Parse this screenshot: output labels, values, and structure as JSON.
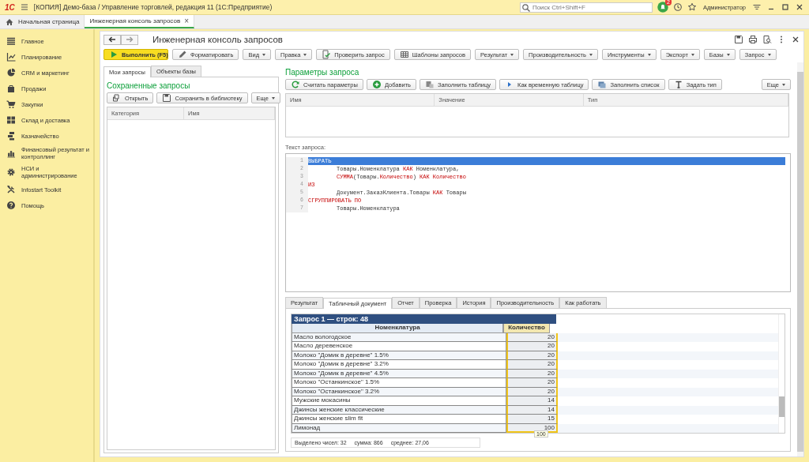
{
  "app": {
    "logo": "1С",
    "title": "[КОПИЯ] Демо-база / Управление торговлей, редакция 11  (1С:Предприятие)",
    "search": {
      "placeholder": "Поиск Ctrl+Shift+F"
    },
    "notifications": "2",
    "user": "Администратор"
  },
  "open_tabs": [
    {
      "label": "Начальная страница",
      "selected": false,
      "closable": false
    },
    {
      "label": "Инженерная консоль запросов",
      "selected": true,
      "closable": true,
      "close": "×"
    }
  ],
  "sidebar": {
    "items": [
      {
        "label": "Главное",
        "selected": false
      },
      {
        "label": "Планирование",
        "selected": false
      },
      {
        "label": "CRM и маркетинг",
        "selected": false
      },
      {
        "label": "Продажи",
        "selected": false
      },
      {
        "label": "Закупки",
        "selected": false
      },
      {
        "label": "Склад и доставка",
        "selected": false
      },
      {
        "label": "Казначейство",
        "selected": false
      },
      {
        "label": "Финансовый результат и контроллинг",
        "selected": false
      },
      {
        "label": "НСИ и администрирование",
        "selected": false
      },
      {
        "label": "Infostart Toolkit",
        "selected": false
      },
      {
        "label": "Помощь",
        "selected": false
      }
    ]
  },
  "form": {
    "title": "Инженерная консоль запросов",
    "toolbar": [
      {
        "label": "Выполнить (F5)",
        "primary": true,
        "dropdown": false
      },
      {
        "label": "Форматировать",
        "primary": false,
        "dropdown": false
      },
      {
        "label": "Вид",
        "primary": false,
        "dropdown": true
      },
      {
        "label": "Правка",
        "primary": false,
        "dropdown": true
      },
      {
        "label": "Проверить запрос",
        "primary": false,
        "dropdown": false
      },
      {
        "label": "Шаблоны запросов",
        "primary": false,
        "dropdown": false
      },
      {
        "label": "Результат",
        "primary": false,
        "dropdown": true
      },
      {
        "label": "Производительность",
        "primary": false,
        "dropdown": true
      },
      {
        "label": "Инструменты",
        "primary": false,
        "dropdown": true
      },
      {
        "label": "Экспорт",
        "primary": false,
        "dropdown": true
      },
      {
        "label": "Базы",
        "primary": false,
        "dropdown": true
      },
      {
        "label": "Запрос",
        "primary": false,
        "dropdown": true
      }
    ]
  },
  "left_panel": {
    "tabs": [
      {
        "label": "Мои запросы",
        "selected": true
      },
      {
        "label": "Объекты базы",
        "selected": false
      }
    ],
    "heading": "Сохраненные запросы",
    "buttons": [
      {
        "label": "Открыть"
      },
      {
        "label": "Сохранить в библиотеку"
      }
    ],
    "more": "Еще",
    "columns": [
      "Категория",
      "Имя"
    ]
  },
  "params": {
    "heading": "Параметры запроса",
    "buttons": [
      {
        "label": "Считать параметры"
      },
      {
        "label": "Добавить"
      },
      {
        "label": "Заполнить таблицу"
      },
      {
        "label": "Как временную таблицу"
      },
      {
        "label": "Заполнить список"
      },
      {
        "label": "Задать тип"
      }
    ],
    "more": "Еще",
    "columns": [
      "Имя",
      "Значение",
      "Тип"
    ]
  },
  "query": {
    "label": "Текст запроса:",
    "lines": [
      {
        "number": "1",
        "indented": false,
        "selected": true,
        "segments": [
          {
            "text": "ВЫБРАТЬ",
            "kind": "keyword"
          }
        ]
      },
      {
        "number": "2",
        "indented": true,
        "selected": false,
        "segments": [
          {
            "text": "Товары.Номенклатура ",
            "kind": "plain"
          },
          {
            "text": "КАК",
            "kind": "keyword"
          },
          {
            "text": " Номенклатура,",
            "kind": "plain"
          }
        ]
      },
      {
        "number": "3",
        "indented": true,
        "selected": false,
        "segments": [
          {
            "text": "СУММА",
            "kind": "keyword"
          },
          {
            "text": "(Товары.",
            "kind": "plain"
          },
          {
            "text": "Количество",
            "kind": "keyword"
          },
          {
            "text": ") ",
            "kind": "plain"
          },
          {
            "text": "КАК Количество",
            "kind": "keyword"
          }
        ]
      },
      {
        "number": "4",
        "indented": false,
        "selected": false,
        "segments": [
          {
            "text": "ИЗ",
            "kind": "keyword"
          }
        ]
      },
      {
        "number": "5",
        "indented": true,
        "selected": false,
        "segments": [
          {
            "text": "Документ.ЗаказКлиента.Товары ",
            "kind": "plain"
          },
          {
            "text": "КАК",
            "kind": "keyword"
          },
          {
            "text": " Товары",
            "kind": "plain"
          }
        ]
      },
      {
        "number": "6",
        "indented": false,
        "selected": false,
        "segments": [
          {
            "text": "СГРУППИРОВАТЬ ПО",
            "kind": "keyword"
          }
        ]
      },
      {
        "number": "7",
        "indented": true,
        "selected": false,
        "segments": [
          {
            "text": "Товары.Номенклатура",
            "kind": "plain"
          }
        ]
      }
    ]
  },
  "result": {
    "tabs": [
      {
        "label": "Результат",
        "selected": false
      },
      {
        "label": "Табличный документ",
        "selected": true
      },
      {
        "label": "Отчет",
        "selected": false
      },
      {
        "label": "Проверка",
        "selected": false
      },
      {
        "label": "История",
        "selected": false
      },
      {
        "label": "Производительность",
        "selected": false
      },
      {
        "label": "Как работать",
        "selected": false
      }
    ],
    "sheet": {
      "title": "Запрос 1 — строк: 48",
      "columns": [
        {
          "label": "Номенклатура",
          "selected": false
        },
        {
          "label": "Количество",
          "selected": true
        }
      ],
      "rows": [
        {
          "name": "Масло вологодское",
          "quantity": "20"
        },
        {
          "name": "Масло деревенское",
          "quantity": "20"
        },
        {
          "name": "Молоко \"Домик в деревне\" 1.5%",
          "quantity": "20"
        },
        {
          "name": "Молоко \"Домик в деревне\" 3.2%",
          "quantity": "20"
        },
        {
          "name": "Молоко \"Домик в деревне\" 4.5%",
          "quantity": "20"
        },
        {
          "name": "Молоко \"Останкинское\" 1.5%",
          "quantity": "20"
        },
        {
          "name": "Молоко \"Останкинское\" 3.2%",
          "quantity": "20"
        },
        {
          "name": "Мужские мокасины",
          "quantity": "14"
        },
        {
          "name": "Джинсы женские классические",
          "quantity": "14"
        },
        {
          "name": "Джинсы женские slim fit",
          "quantity": "15"
        },
        {
          "name": "Лимонад",
          "quantity": "100"
        }
      ],
      "tooltip": "100"
    },
    "summary": [
      "Выделено чисел: 32",
      "сумма: 866",
      "среднее: 27,06"
    ]
  }
}
